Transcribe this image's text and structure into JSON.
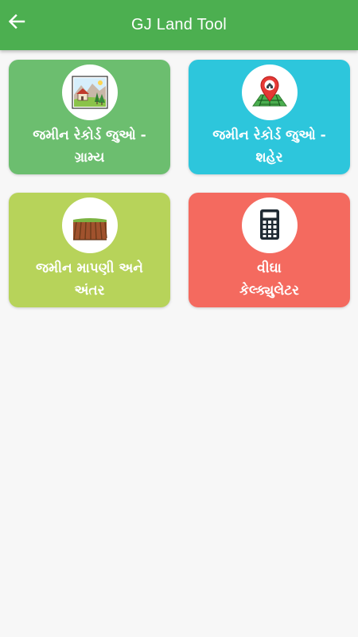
{
  "app_bar": {
    "title": "GJ Land Tool",
    "background_color": "#4caf50",
    "back_icon": "arrow-left-icon"
  },
  "cards": [
    {
      "line1": "જમીન રેકોર્ડ જુઓ -",
      "line2": "ગ્રામ્ય",
      "color": "#6cbe6f",
      "icon": "rural-landscape-icon"
    },
    {
      "line1": "જમીન રેકોર્ડ જુઓ -",
      "line2": "શહેર",
      "color": "#2dc6dc",
      "icon": "map-pin-icon"
    },
    {
      "line1": "જમીન માપણી અને",
      "line2": "અંતર",
      "color": "#b7d35a",
      "icon": "farm-field-icon"
    },
    {
      "line1": "વીઘા",
      "line2": "કેલ્ક્યુલેટર",
      "color": "#f46a5f",
      "icon": "calculator-icon"
    }
  ]
}
